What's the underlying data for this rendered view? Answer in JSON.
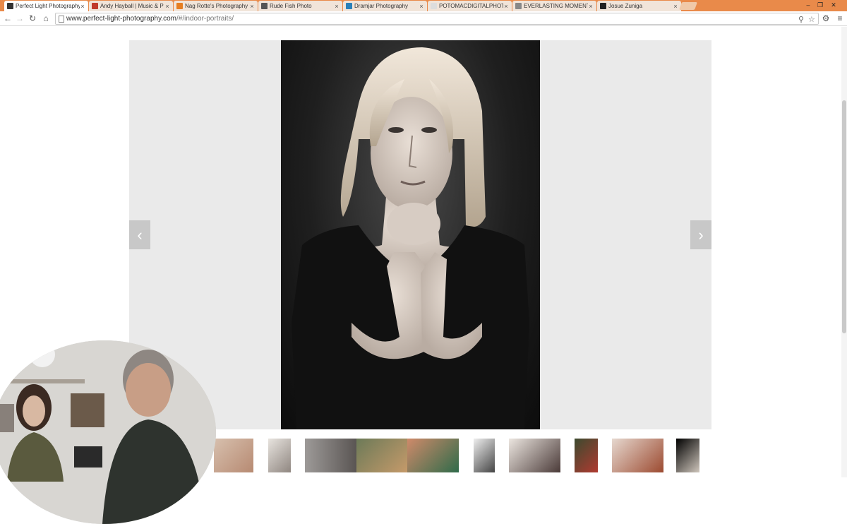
{
  "browser": {
    "tabs": [
      {
        "label": "Perfect Light Photography",
        "favicon": "camera-icon",
        "fav_color": "#333333",
        "active": true
      },
      {
        "label": "Andy Hayball | Music & P",
        "favicon": "ah-icon",
        "fav_color": "#c0392b",
        "active": false
      },
      {
        "label": "Nag Rotte's Photography",
        "favicon": "n-icon",
        "fav_color": "#e67e22",
        "active": false
      },
      {
        "label": "Rude Fish Photo",
        "favicon": "fish-icon",
        "fav_color": "#555555",
        "active": false
      },
      {
        "label": "Dramjar Photography",
        "favicon": "x-icon",
        "fav_color": "#2980b9",
        "active": false
      },
      {
        "label": "POTOMACDIGITALPHOT",
        "favicon": "blank-icon",
        "fav_color": "#dddddd",
        "active": false
      },
      {
        "label": "EVERLASTING MOMENTS",
        "favicon": "globe-icon",
        "fav_color": "#888888",
        "active": false
      },
      {
        "label": "Josue Zuniga",
        "favicon": "z-icon",
        "fav_color": "#222222",
        "active": false
      }
    ],
    "url_host": "www.perfect-light-photography.com",
    "url_path": "/#/indoor-portraits/",
    "close_glyph": "×",
    "win_controls": [
      "–",
      "❐",
      "✕"
    ],
    "nav_glyphs": {
      "back": "←",
      "forward": "→",
      "reload": "↻",
      "home": "⌂",
      "menu": "≡"
    },
    "omni_icons": {
      "zoom": "⚲",
      "star": "☆",
      "extension": "⚙"
    }
  },
  "gallery": {
    "prev_glyph": "‹",
    "next_glyph": "›",
    "thumb_count": 11
  },
  "colors": {
    "tabstrip": "#e98a4a",
    "gallery_bg": "#eaeaea",
    "arrow_bg": "#c8c8c8"
  }
}
